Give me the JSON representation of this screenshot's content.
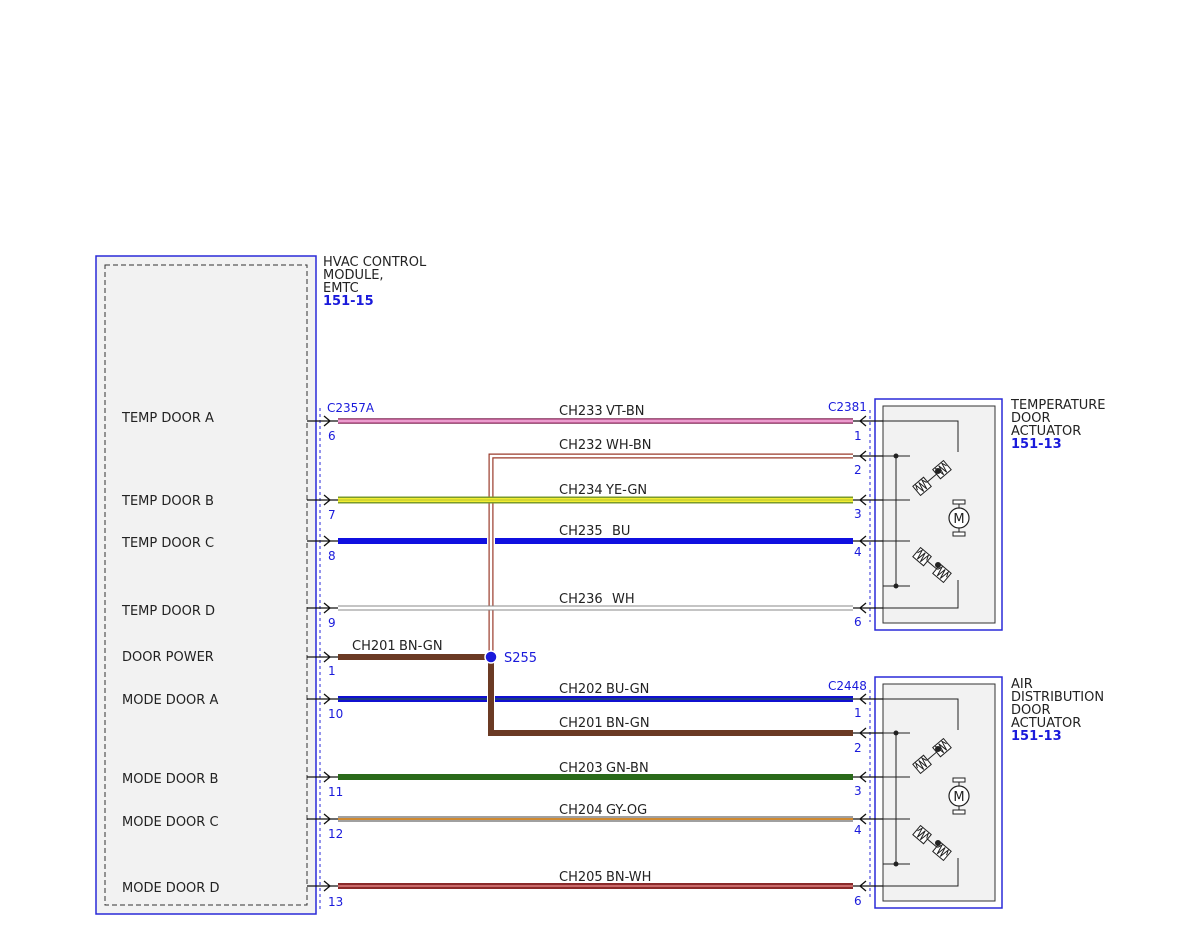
{
  "colors": {
    "frame": "#2a2ad8",
    "wire_text": "#222222",
    "pin_text": "#1a1adb",
    "module_fill": "#f2f2f2",
    "splice": "#1a1adb"
  },
  "module": {
    "title_lines": [
      "HVAC CONTROL",
      "MODULE,",
      "EMTC"
    ],
    "ref": "151-15",
    "connector": "C2357A",
    "signals": [
      {
        "id": "temp-door-a",
        "label": "TEMP DOOR A",
        "pin": "6"
      },
      {
        "id": "temp-door-b",
        "label": "TEMP DOOR B",
        "pin": "7"
      },
      {
        "id": "temp-door-c",
        "label": "TEMP DOOR C",
        "pin": "8"
      },
      {
        "id": "temp-door-d",
        "label": "TEMP DOOR D",
        "pin": "9"
      },
      {
        "id": "door-power",
        "label": "DOOR POWER",
        "pin": "1"
      },
      {
        "id": "mode-door-a",
        "label": "MODE DOOR A",
        "pin": "10"
      },
      {
        "id": "mode-door-b",
        "label": "MODE DOOR B",
        "pin": "11"
      },
      {
        "id": "mode-door-c",
        "label": "MODE DOOR C",
        "pin": "12"
      },
      {
        "id": "mode-door-d",
        "label": "MODE DOOR D",
        "pin": "13"
      }
    ]
  },
  "splice": {
    "label": "S255"
  },
  "actuators": [
    {
      "id": "temperature-door-actuator",
      "title_lines": [
        "TEMPERATURE",
        "DOOR",
        "ACTUATOR"
      ],
      "ref": "151-13",
      "connector": "C2381",
      "pins": [
        "1",
        "2",
        "3",
        "4",
        "6"
      ],
      "motor_symbol": "M"
    },
    {
      "id": "air-distribution-door-actuator",
      "title_lines": [
        "AIR",
        "DISTRIBUTION",
        "DOOR",
        "ACTUATOR"
      ],
      "ref": "151-13",
      "connector": "C2448",
      "pins": [
        "1",
        "2",
        "3",
        "4",
        "6"
      ],
      "motor_symbol": "M"
    }
  ],
  "wires": [
    {
      "circuit": "CH233",
      "color_code": "VT-BN",
      "from": "temp-door-a",
      "to_pin": "1",
      "colors": [
        "#e060b0",
        "#a06080"
      ]
    },
    {
      "circuit": "CH232",
      "color_code": "WH-BN",
      "from": "S255",
      "to_pin": "2",
      "colors": [
        "#ffffff",
        "#9a3a2a"
      ]
    },
    {
      "circuit": "CH234",
      "color_code": "YE-GN",
      "from": "temp-door-b",
      "to_pin": "3",
      "colors": [
        "#f2ee30",
        "#7a9a2a"
      ]
    },
    {
      "circuit": "CH235",
      "color_code": "BU",
      "from": "temp-door-c",
      "to_pin": "4",
      "colors": [
        "#1010e0",
        "#1010e0"
      ]
    },
    {
      "circuit": "CH236",
      "color_code": "WH",
      "from": "temp-door-d",
      "to_pin": "6",
      "colors": [
        "#ffffff",
        "#888888"
      ]
    },
    {
      "circuit": "CH201",
      "color_code": "BN-GN",
      "from": "door-power",
      "to_pin": "S255",
      "colors": [
        "#6b3a24",
        "#6b3a24"
      ]
    },
    {
      "circuit": "CH202",
      "color_code": "BU-GN",
      "from": "mode-door-a",
      "to_pin": "1",
      "colors": [
        "#1010d0",
        "#2a6a2a"
      ]
    },
    {
      "circuit": "CH201",
      "color_code": "BN-GN",
      "from": "S255",
      "to_pin": "2",
      "colors": [
        "#6b3a24",
        "#6b3a24"
      ]
    },
    {
      "circuit": "CH203",
      "color_code": "GN-BN",
      "from": "mode-door-b",
      "to_pin": "3",
      "colors": [
        "#2a6a1a",
        "#2a6a1a"
      ]
    },
    {
      "circuit": "CH204",
      "color_code": "GY-OG",
      "from": "mode-door-c",
      "to_pin": "4",
      "colors": [
        "#a0a0a0",
        "#d08a30"
      ]
    },
    {
      "circuit": "CH205",
      "color_code": "BN-WH",
      "from": "mode-door-d",
      "to_pin": "6",
      "colors": [
        "#8a2a2a",
        "#e08080"
      ]
    }
  ]
}
